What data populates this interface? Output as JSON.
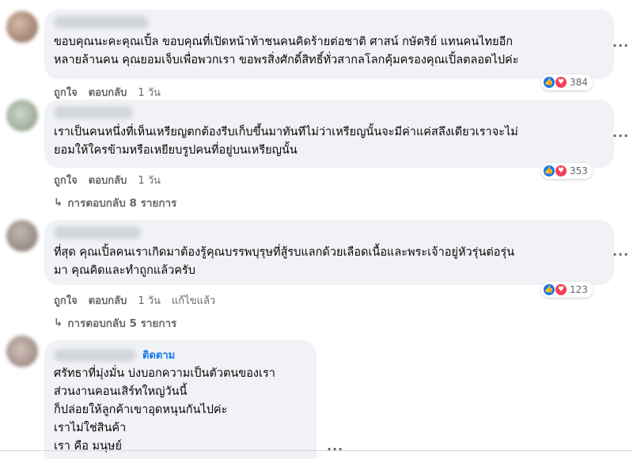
{
  "comments": [
    {
      "text": "ขอบคุณนะคะคุณเปิ้ล ขอบคุณที่เปิดหน้าท้าชนคนคิดร้ายต่อชาติ ศาสน์ กษัตริย์ แทนคนไทยอีก\nหลายล้านคน คุณยอมเจ็บเพื่อพวกเรา ขอพรสิ่งศักดิ์สิทธิ์ทั่วสากลโลกคุ้มครองคุณเปิ้ลตลอดไปค่ะ",
      "like": "ถูกใจ",
      "reply": "ตอบกลับ",
      "time": "1 วัน",
      "reaction_count": "384"
    },
    {
      "text": "เราเป็นคนหนึ่งที่เห็นเหรียญตกต้องรีบเก็บขึ้นมาทันทีไม่ว่าเหรียญนั้นจะมีค่าแค่สลึงเดียวเราจะไม่\nยอมให้ใครข้ามหรือเหยียบรูปคนที่อยู่บนเหรียญนั้น",
      "like": "ถูกใจ",
      "reply": "ตอบกลับ",
      "time": "1 วัน",
      "reaction_count": "353",
      "replies_label": "การตอบกลับ 8 รายการ"
    },
    {
      "text": "ที่สุด คุณเปิ้ลคนเราเกิดมาต้องรู้คุณบรรพบุรุษที่สู้รบแลกด้วยเลือดเนื้อและพระเจ้าอยู่หัวรุ่นต่อรุ่น\nมา คุณคิดและทำถูกแล้วครับ",
      "like": "ถูกใจ",
      "reply": "ตอบกลับ",
      "time": "1 วัน",
      "edited": "แก้ไขแล้ว",
      "reaction_count": "123",
      "replies_label": "การตอบกลับ 5 รายการ"
    },
    {
      "follow": "ติดตาม",
      "text": "ศรัทธาที่มุ่งมั่น บ่งบอกความเป็นตัวตนของเรา\nส่วนงานคอนเสิร์ทใหญ่วันนี้\nก็ปล่อยให้ลูกค้าเขาอุดหนุนกันไปค่ะ\nเราไม่ใช่สินค้า\nเรา คือ มนุษย์"
    }
  ],
  "more_glyph": "···",
  "reply_arrow": "↳",
  "colors": {
    "bubble": "#f0f2f5",
    "meta": "#65676b",
    "like": "#1877f2",
    "love": "#f33e58"
  }
}
